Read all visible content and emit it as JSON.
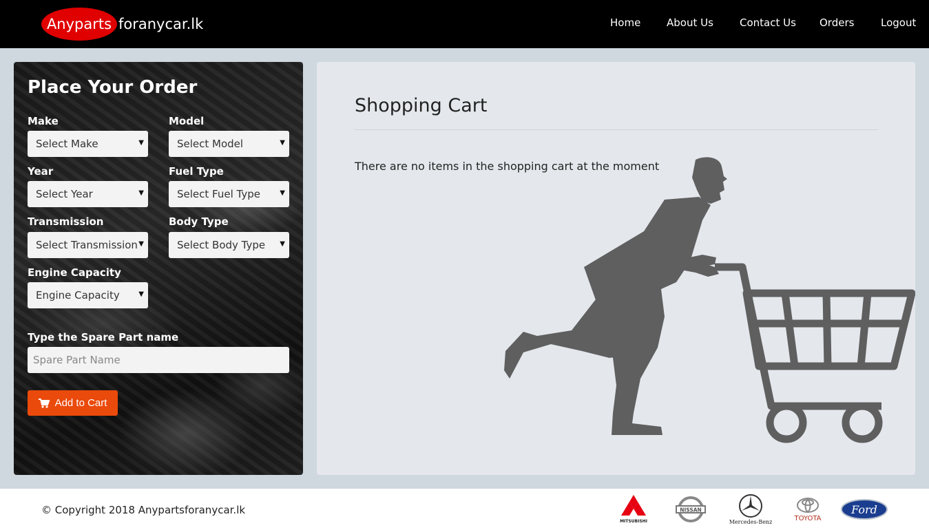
{
  "brand": {
    "highlight": "Anyparts",
    "rest": "foranycar.lk"
  },
  "nav": {
    "items": [
      "Home",
      "About Us",
      "Contact Us",
      "Orders",
      "Logout"
    ]
  },
  "order_form": {
    "title": "Place Your Order",
    "fields": [
      {
        "label": "Make",
        "value": "Select Make"
      },
      {
        "label": "Model",
        "value": "Select Model"
      },
      {
        "label": "Year",
        "value": "Select Year"
      },
      {
        "label": "Fuel Type",
        "value": "Select Fuel Type"
      },
      {
        "label": "Transmission",
        "value": "Select Transmission"
      },
      {
        "label": "Body Type",
        "value": "Select Body Type"
      },
      {
        "label": "Engine Capacity",
        "value": "Engine Capacity"
      }
    ],
    "part_label": "Type the Spare Part name",
    "part_placeholder": "Spare Part Name",
    "add_button": "Add to Cart"
  },
  "cart": {
    "title": "Shopping Cart",
    "empty_message": "There are no items in the shopping cart at the moment"
  },
  "footer": {
    "copyright": "© Copyright 2018 Anypartsforanycar.lk",
    "logos": [
      {
        "name": "mitsubishi-logo",
        "caption": "MITSUBISHI",
        "color": "#e60012"
      },
      {
        "name": "nissan-logo",
        "caption": "",
        "color": "#777777"
      },
      {
        "name": "mercedes-logo",
        "caption": "Mercedes-Benz",
        "color": "#333333"
      },
      {
        "name": "toyota-logo",
        "caption": "TOYOTA",
        "color": "#c0392b"
      },
      {
        "name": "ford-logo",
        "caption": "Ford",
        "color": "#1a3d8f"
      }
    ]
  },
  "colors": {
    "navbar": "#000000",
    "brand_red": "#e00000",
    "button_orange": "#ea4a0b",
    "silhouette": "#5f5f60"
  }
}
